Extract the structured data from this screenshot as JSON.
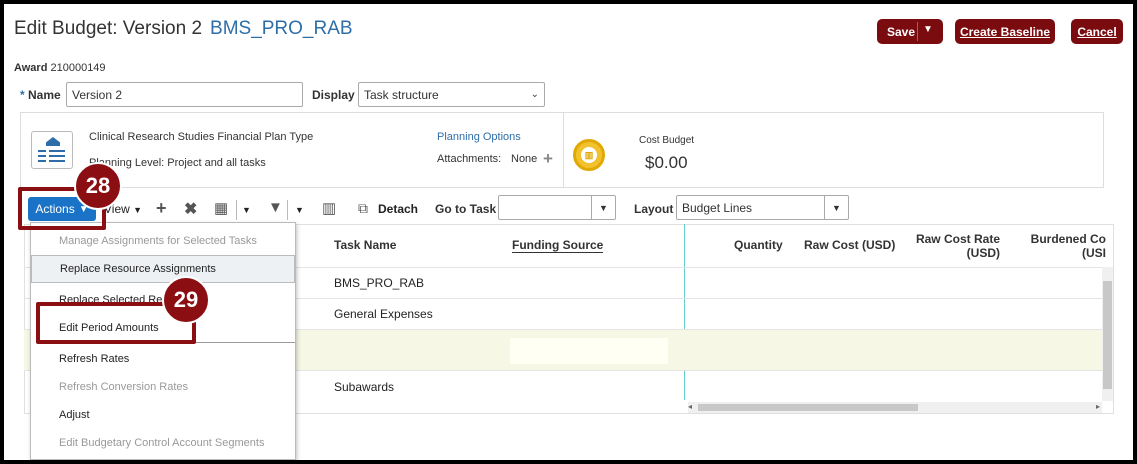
{
  "header": {
    "title": "Edit Budget: Version 2",
    "project": "BMS_PRO_RAB",
    "save_label": "Save",
    "create_baseline_label": "Create Baseline",
    "cancel_label": "Cancel"
  },
  "award": {
    "label": "Award",
    "value": "210000149"
  },
  "form": {
    "name_label": "Name",
    "name_value": "Version 2",
    "display_label": "Display",
    "display_value": "Task structure"
  },
  "plan": {
    "plan_type": "Clinical Research Studies Financial Plan Type",
    "planning_level": "Planning Level: Project and all tasks",
    "planning_options": "Planning Options",
    "attachments_label": "Attachments:",
    "attachments_value": "None",
    "cost_budget_label": "Cost Budget",
    "cost_budget_value": "$0.00"
  },
  "toolbar": {
    "actions_label": "Actions",
    "view_label": "View",
    "detach_label": "Detach",
    "go_to_task_label": "Go to Task",
    "layout_label": "Layout",
    "layout_value": "Budget Lines"
  },
  "table": {
    "columns": {
      "task_name": "Task Name",
      "funding_source": "Funding Source",
      "quantity": "Quantity",
      "raw_cost": "Raw Cost (USD)",
      "raw_cost_rate_1": "Raw Cost Rate",
      "raw_cost_rate_2": "(USD)",
      "burdened_1": "Burdened Co",
      "burdened_2": "(USI"
    },
    "rows": [
      "BMS_PRO_RAB",
      "General Expenses",
      "",
      "Subawards"
    ]
  },
  "menu": {
    "items": [
      "Manage Assignments for Selected Tasks",
      "Replace Resource Assignments",
      "Replace Selected Re",
      "Edit Period Amounts",
      "Refresh Rates",
      "Refresh Conversion Rates",
      "Adjust",
      "Edit Budgetary Control Account Segments"
    ]
  },
  "callouts": {
    "step1": "28",
    "step2": "29"
  },
  "colors": {
    "brand_dark": "#7a0c10",
    "link": "#2e6ea8",
    "actions_blue": "#1a73c7",
    "callout": "#8b0e13"
  }
}
